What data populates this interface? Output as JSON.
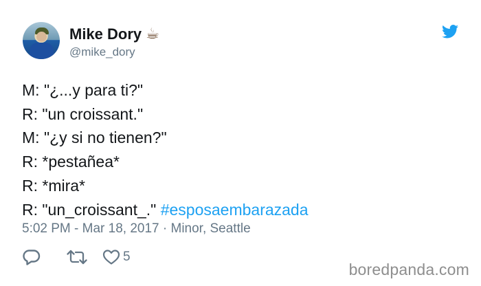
{
  "user": {
    "name": "Mike Dory",
    "name_emoji": "☕",
    "handle": "@mike_dory"
  },
  "tweet": {
    "lines": [
      "M: \"¿...y para ti?\"",
      "R: \"un croissant.\"",
      "M: \"¿y si no tienen?\"",
      "R: *pestañea*",
      "R: *mira*"
    ],
    "last_line_prefix": "R: \"un_croissant_.\" ",
    "hashtag": "#esposaembarazada",
    "meta": "5:02 PM - Mar 18, 2017 · Minor, Seattle",
    "like_count": "5"
  },
  "icons": {
    "brand": "twitter-bird-icon",
    "reply": "reply-icon",
    "retweet": "retweet-icon",
    "like": "heart-icon"
  },
  "colors": {
    "link": "#1da1f2",
    "muted": "#657786",
    "text": "#14171a"
  },
  "watermark": "boredpanda.com"
}
